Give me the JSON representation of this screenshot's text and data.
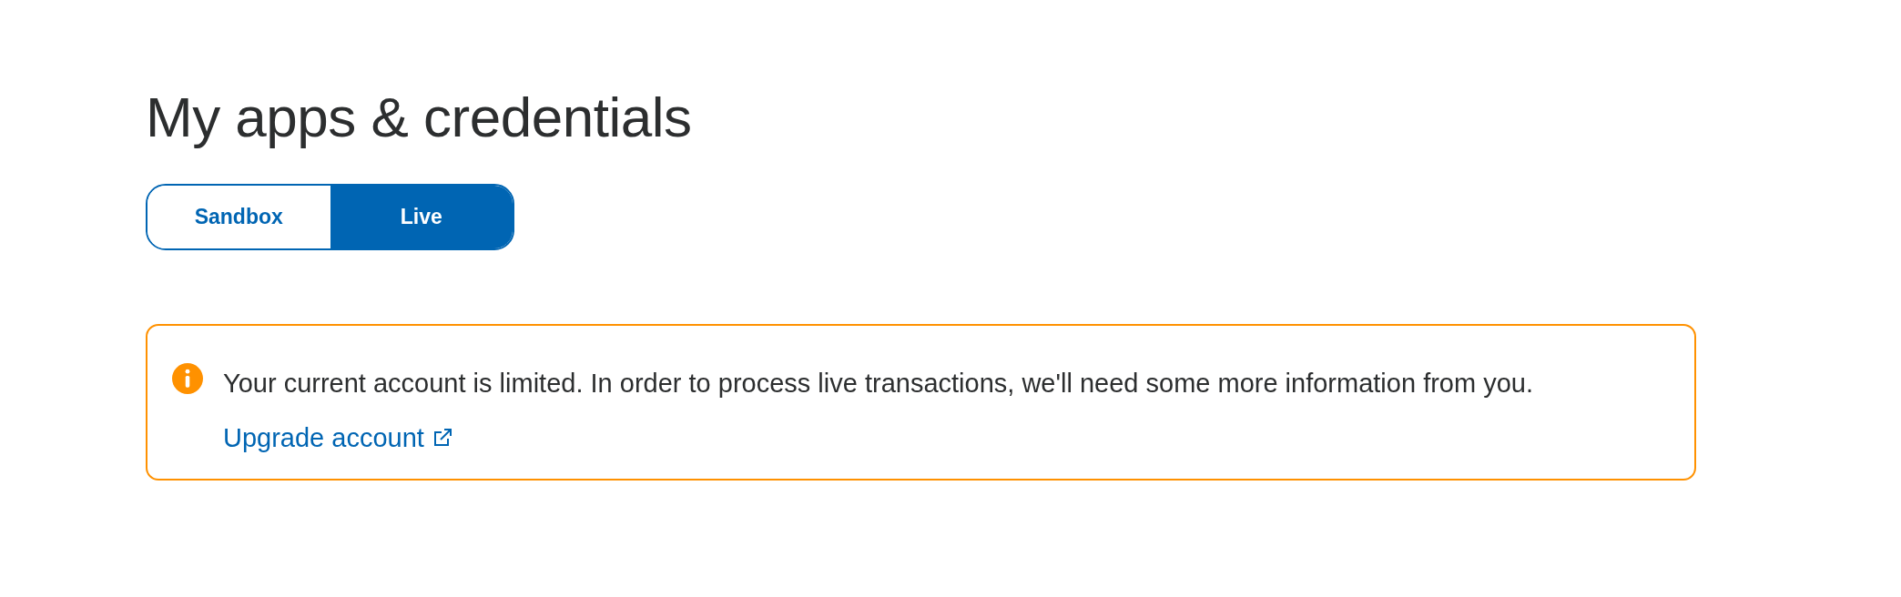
{
  "title": "My apps & credentials",
  "tabs": [
    {
      "label": "Sandbox",
      "selected": false
    },
    {
      "label": "Live",
      "selected": true
    }
  ],
  "alert": {
    "kind": "warning",
    "message": "Your current account is limited. In order to process live transactions, we'll need some more information from you.",
    "link": "Upgrade account"
  }
}
